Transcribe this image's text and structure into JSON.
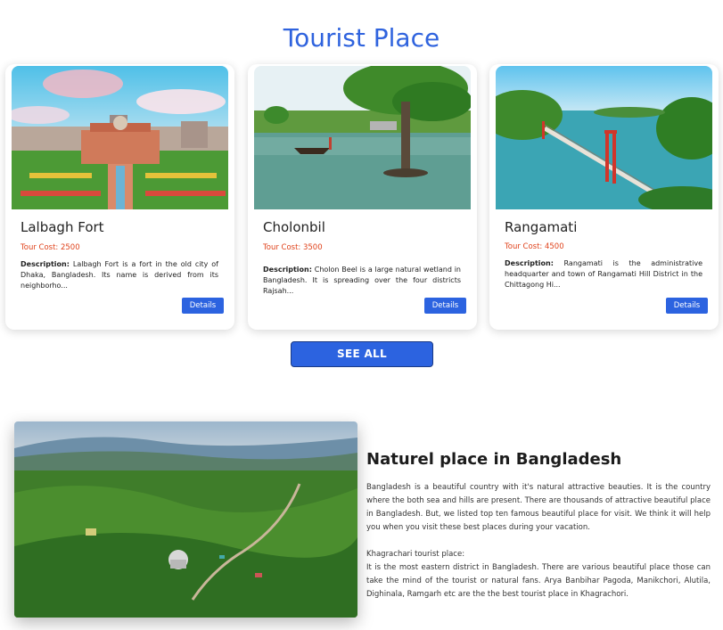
{
  "section": {
    "title": "Tourist Place"
  },
  "cards": [
    {
      "name": "Lalbagh Fort",
      "cost": "Tour Cost: 2500",
      "desc_label": "Description:",
      "desc_text": " Lalbagh Fort is a fort in the old city of Dhaka, Bangladesh. Its name is derived from its neighborho...",
      "button": "Details",
      "image": "lalbagh-fort-photo"
    },
    {
      "name": "Cholonbil",
      "cost": "Tour Cost: 3500",
      "desc_label": "Description:",
      "desc_text": " Cholon Beel is a large natural wetland in Bangladesh. It is spreading over the four districts Rajsah...",
      "button": "Details",
      "image": "cholonbil-photo"
    },
    {
      "name": "Rangamati",
      "cost": "Tour Cost: 4500",
      "desc_label": "Description:",
      "desc_text": " Rangamati is the administrative headquarter and town of Rangamati Hill District in the Chittagong Hi...",
      "button": "Details",
      "image": "rangamati-photo"
    }
  ],
  "see_all": "SEE ALL",
  "nature": {
    "title": "Naturel place in Bangladesh",
    "paragraph1": "Bangladesh is a beautiful country with it's natural attractive beauties. It is the country where the both sea and hills are present. There are thousands of attractive beautiful place in Bangladesh. But, we listed top ten famous beautiful place for visit. We think it will help you when you visit these best places during your vacation.",
    "paragraph2_heading": "Khagrachari tourist place:",
    "paragraph2": "It is the most eastern district in Bangladesh. There are various beautiful place those can take the mind of the tourist or natural fans. Arya Banbihar Pagoda, Manikchori, Alutila, Dighinala, Ramgarh etc are the the best tourist place in Khagrachori.",
    "image": "khagrachari-hills-photo"
  },
  "colors": {
    "accent": "#2c63e0",
    "title": "#2f63de",
    "cost": "#e0431c"
  }
}
